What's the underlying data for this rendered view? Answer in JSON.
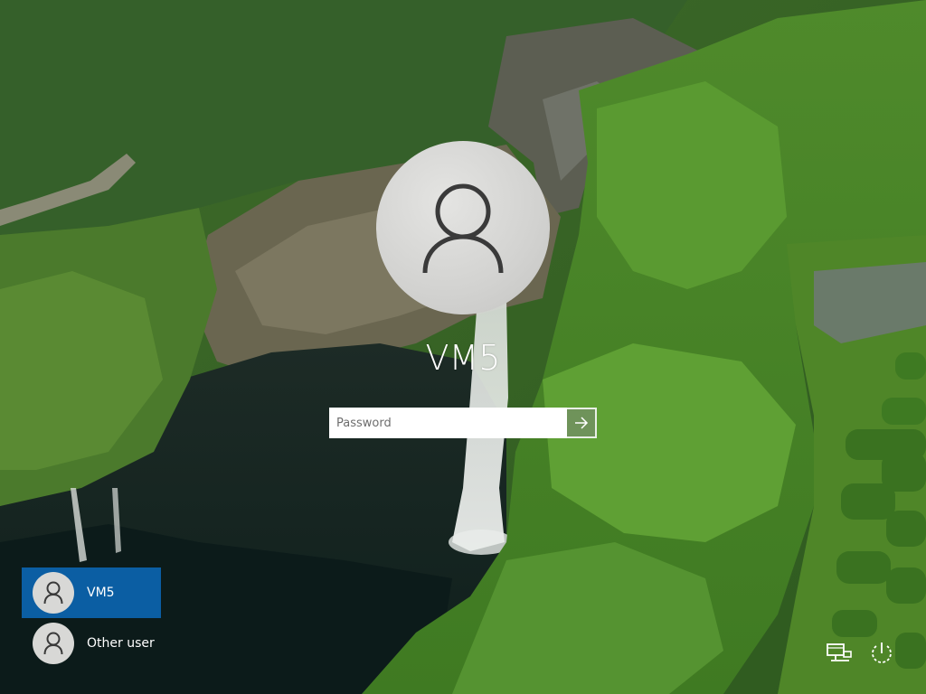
{
  "lock_screen": {
    "user_name": "VM5",
    "password": {
      "placeholder": "Password",
      "value": ""
    },
    "submit_icon": "arrow-right-icon"
  },
  "user_list": [
    {
      "label": "VM5",
      "selected": true,
      "icon": "user-icon"
    },
    {
      "label": "Other user",
      "selected": false,
      "icon": "user-icon"
    }
  ],
  "corner_icons": [
    {
      "name": "network-icon"
    },
    {
      "name": "power-icon"
    }
  ],
  "colors": {
    "selected_tile": "#0b5ea3",
    "text": "#ffffff",
    "avatar_bg": "#d8d8d6",
    "avatar_glyph": "#3a3a3a"
  }
}
